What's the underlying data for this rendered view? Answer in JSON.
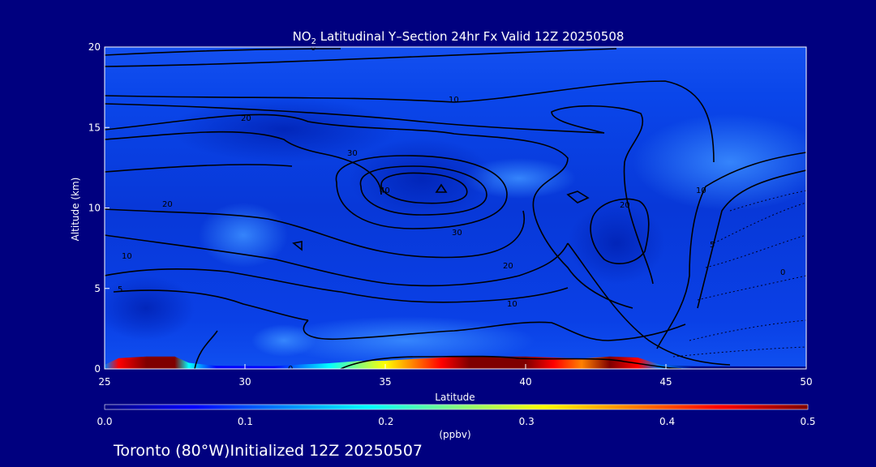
{
  "chart_data": {
    "type": "heatmap",
    "title_prefix": "NO",
    "title_sub": "2",
    "title_suffix": " Latitudinal Y–Section 24hr  Fx Valid 12Z 20250508",
    "xlabel": "Latitude",
    "ylabel": "Altitude (km)",
    "xlim": [
      25,
      50
    ],
    "ylim": [
      0,
      20
    ],
    "x_ticks": [
      25,
      30,
      35,
      40,
      45,
      50
    ],
    "y_ticks": [
      0,
      5,
      10,
      15,
      20
    ],
    "colorbar": {
      "min": 0.0,
      "max": 0.5,
      "ticks": [
        "0.0",
        "0.1",
        "0.2",
        "0.3",
        "0.4",
        "0.5"
      ],
      "unit": "(ppbv)",
      "colors": [
        "#00007f",
        "#0000ff",
        "#0080ff",
        "#00ffff",
        "#80ff80",
        "#ffff00",
        "#ff8000",
        "#ff0000",
        "#7f0000"
      ]
    },
    "no2_surface_layer": [
      {
        "lat": 25.0,
        "value": 0.1
      },
      {
        "lat": 25.5,
        "value": 0.42
      },
      {
        "lat": 26.5,
        "value": 0.5
      },
      {
        "lat": 27.5,
        "value": 0.5
      },
      {
        "lat": 28.0,
        "value": 0.2
      },
      {
        "lat": 29.0,
        "value": 0.05
      },
      {
        "lat": 31.0,
        "value": 0.04
      },
      {
        "lat": 32.0,
        "value": 0.12
      },
      {
        "lat": 33.0,
        "value": 0.18
      },
      {
        "lat": 34.0,
        "value": 0.28
      },
      {
        "lat": 35.0,
        "value": 0.3
      },
      {
        "lat": 36.0,
        "value": 0.38
      },
      {
        "lat": 37.0,
        "value": 0.45
      },
      {
        "lat": 38.0,
        "value": 0.5
      },
      {
        "lat": 39.0,
        "value": 0.5
      },
      {
        "lat": 40.0,
        "value": 0.5
      },
      {
        "lat": 41.0,
        "value": 0.45
      },
      {
        "lat": 42.0,
        "value": 0.4
      },
      {
        "lat": 43.0,
        "value": 0.5
      },
      {
        "lat": 44.0,
        "value": 0.45
      },
      {
        "lat": 44.8,
        "value": 0.1
      },
      {
        "lat": 46.0,
        "value": 0.03
      },
      {
        "lat": 50.0,
        "value": 0.02
      }
    ],
    "contour_labels": [
      "0",
      "5",
      "10",
      "20",
      "30",
      "40",
      "10",
      "20",
      "30",
      "10",
      "20",
      "5",
      "0",
      "0",
      "10",
      "20",
      "30"
    ]
  },
  "footer": {
    "text": "Toronto (80°W)Initialized 12Z 20250507"
  }
}
